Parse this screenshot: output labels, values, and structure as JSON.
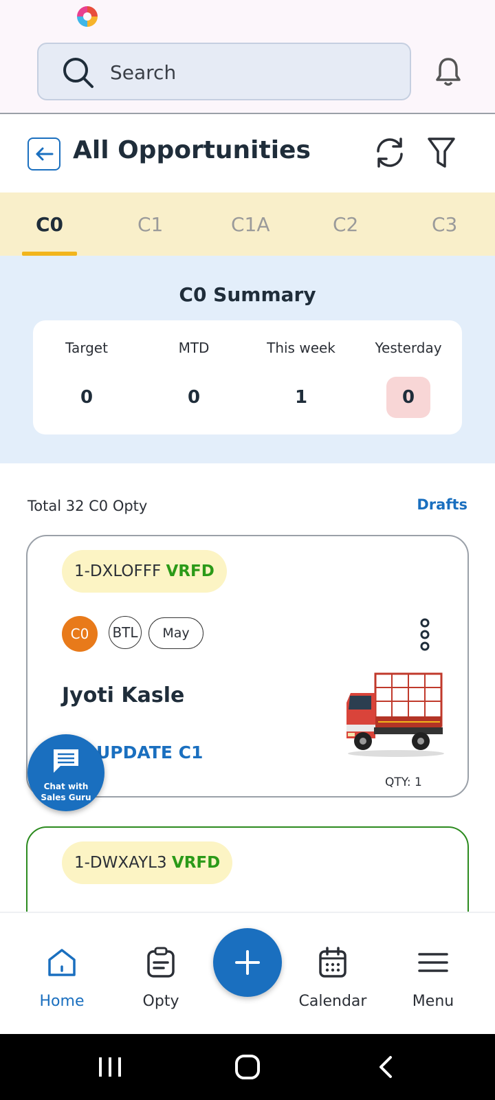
{
  "search": {
    "placeholder": "Search"
  },
  "header": {
    "title": "All Opportunities"
  },
  "tabs": [
    {
      "label": "C0",
      "active": true
    },
    {
      "label": "C1",
      "active": false
    },
    {
      "label": "C1A",
      "active": false
    },
    {
      "label": "C2",
      "active": false
    },
    {
      "label": "C3",
      "active": false
    }
  ],
  "summary": {
    "title": "C0 Summary",
    "metrics": [
      {
        "label": "Target",
        "value": "0"
      },
      {
        "label": "MTD",
        "value": "0"
      },
      {
        "label": "This week",
        "value": "1"
      },
      {
        "label": "Yesterday",
        "value": "0",
        "highlight": true
      }
    ]
  },
  "list": {
    "total_label": "Total 32 C0 Opty",
    "drafts_label": "Drafts"
  },
  "cards": [
    {
      "opty_id": "1-DXLOFFF",
      "status": "VRFD",
      "stage": "C0",
      "source": "BTL",
      "month": "May",
      "customer": "Jyoti Kasle",
      "action": "UPDATE C1",
      "qty": "QTY: 1"
    },
    {
      "opty_id": "1-DWXAYL3",
      "status": "VRFD"
    }
  ],
  "chat": {
    "line1": "Chat with",
    "line2": "Sales Guru"
  },
  "nav": {
    "home": "Home",
    "opty": "Opty",
    "calendar": "Calendar",
    "menu": "Menu"
  },
  "colors": {
    "primary": "#1a6fbf",
    "tab_bar": "#f9efca",
    "tab_underline": "#f2b51c",
    "summary_bg": "#e3eefa",
    "verified": "#2b9a18",
    "stage_badge": "#e87a1a",
    "highlight": "#f8d6d6"
  }
}
